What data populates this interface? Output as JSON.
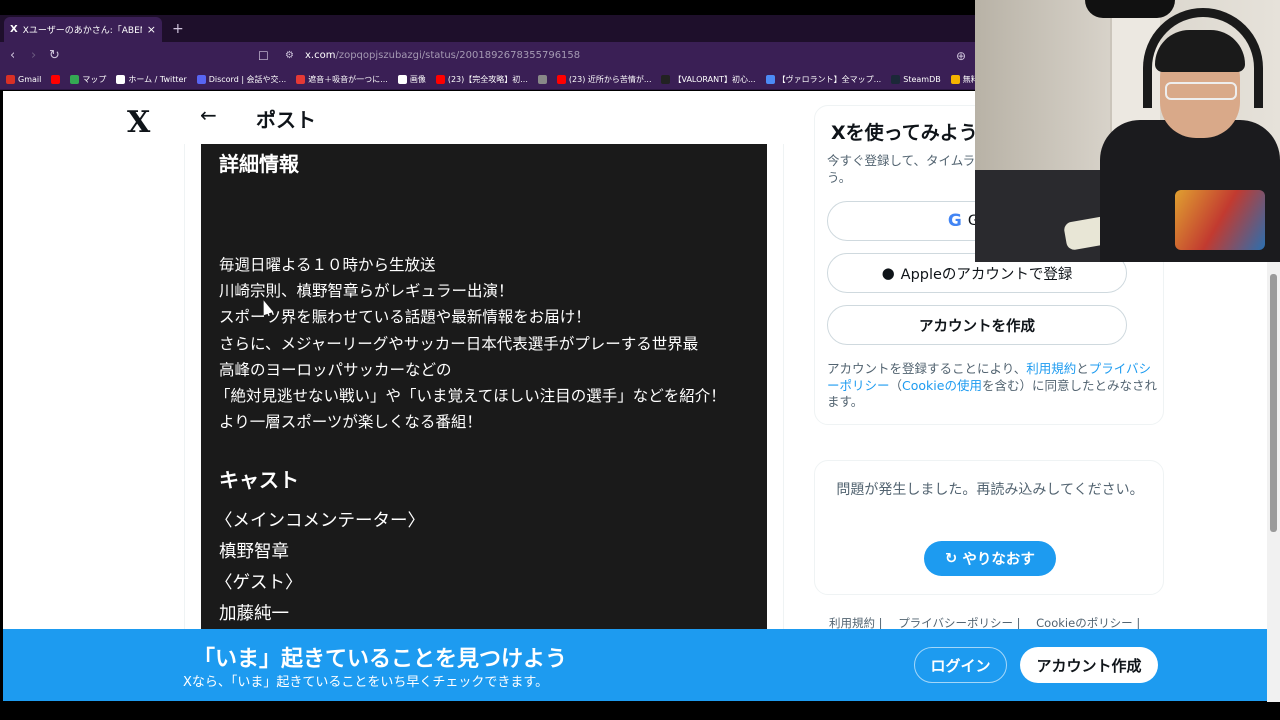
{
  "browser": {
    "tab_title": "Xユーザーのあかさん:「ABEMAに加...",
    "new_tab": "+",
    "url_domain": "x.com",
    "url_path": "/zopqopjszubazgi/status/2001892678355796158",
    "bookmarks": [
      {
        "label": "Gmail",
        "color": "#d93025"
      },
      {
        "label": "",
        "color": "#ff0000"
      },
      {
        "label": "マップ",
        "color": "#34a853"
      },
      {
        "label": "ホーム / Twitter",
        "color": "#ffffff"
      },
      {
        "label": "Discord | 会話や交...",
        "color": "#5865f2"
      },
      {
        "label": "遮音＋吸音が一つに...",
        "color": "#e53935"
      },
      {
        "label": "画像",
        "color": "#ffffff"
      },
      {
        "label": "(23)【完全攻略】初...",
        "color": "#ff0000"
      },
      {
        "label": "",
        "color": "#888888"
      },
      {
        "label": "(23) 近所から苦情が...",
        "color": "#ff0000"
      },
      {
        "label": "【VALORANT】初心...",
        "color": "#222222"
      },
      {
        "label": "【ヴァロラント】全マップ...",
        "color": "#4c8bf5"
      },
      {
        "label": "SteamDB",
        "color": "#1b2838"
      },
      {
        "label": "無料のオ",
        "color": "#f4b400"
      }
    ]
  },
  "header": {
    "logo": "X",
    "back": "←",
    "title": "ポスト"
  },
  "post": {
    "details_heading": "詳細情報",
    "description_lines": [
      "毎週日曜よる１０時から生放送",
      "川崎宗則、槙野智章らがレギュラー出演！",
      "スポーツ界を賑わせている話題や最新情報をお届け！",
      "さらに、メジャーリーグやサッカー日本代表選手がプレーする世界最",
      "高峰のヨーロッパサッカーなどの",
      "「絶対見逃せない戦い」や「いま覚えてほしい注目の選手」などを紹介！",
      "より一層スポーツが楽しくなる番組！"
    ],
    "cast_heading": "キャスト",
    "cast_lines": [
      "〈メインコメンテーター〉",
      "槙野智章",
      "〈ゲスト〉",
      "加藤純一"
    ]
  },
  "signup": {
    "title": "Xを使ってみよう",
    "subtitle": "今すぐ登録して、タイムラインをカスタマイズしましょう。",
    "google_label": "Goog",
    "apple_label": "Appleのアカウントで登録",
    "create_label": "アカウントを作成",
    "terms_prefix": "アカウントを登録することにより、",
    "terms_link1": "利用規約",
    "terms_and": "と",
    "terms_link2": "プライバシーポリシー",
    "terms_mid": "（",
    "terms_link3": "Cookieの使用",
    "terms_suffix": "を含む）に同意したとみなされます。"
  },
  "error": {
    "message": "問題が発生しました。再読み込みしてください。",
    "retry_label": "やりなおす"
  },
  "footer": {
    "links": [
      "利用規約 |",
      "プライバシーポリシー |",
      "Cookieのポリシー |"
    ]
  },
  "bottom_banner": {
    "title": "「いま」起きていることを見つけよう",
    "subtitle": "Xなら、「いま」起きていることをいち早くチェックできます。",
    "login": "ログイン",
    "create": "アカウント作成"
  },
  "colors": {
    "x_blue": "#1d9bf0",
    "browser_chrome": "#3a1f55"
  }
}
